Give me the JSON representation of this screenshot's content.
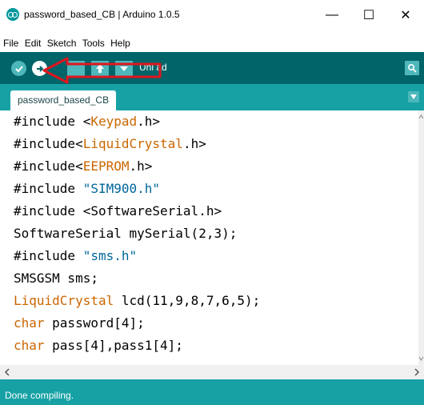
{
  "window": {
    "title": "password_based_CB | Arduino 1.0.5",
    "minimize": "—",
    "maximize": "☐",
    "close": "✕"
  },
  "menu": [
    "File",
    "Edit",
    "Sketch",
    "Tools",
    "Help"
  ],
  "toolbar": {
    "hover_label": "Unl  ad",
    "accent_color": "#006468",
    "arrow_color": "#e0161f"
  },
  "tabs": [
    {
      "label": "password_based_CB"
    }
  ],
  "code": [
    [
      {
        "t": "#include ",
        "c": "#000000"
      },
      {
        "t": "<",
        "c": "#000000"
      },
      {
        "t": "Keypad",
        "c": "#cc6600"
      },
      {
        "t": ".h>",
        "c": "#000000"
      }
    ],
    [
      {
        "t": "#include<",
        "c": "#000000"
      },
      {
        "t": "LiquidCrystal",
        "c": "#cc6600"
      },
      {
        "t": ".h>",
        "c": "#000000"
      }
    ],
    [
      {
        "t": "#include<",
        "c": "#000000"
      },
      {
        "t": "EEPROM",
        "c": "#cc6600"
      },
      {
        "t": ".h>",
        "c": "#000000"
      }
    ],
    [
      {
        "t": "#include ",
        "c": "#000000"
      },
      {
        "t": "\"SIM900.h\"",
        "c": "#006699"
      }
    ],
    [
      {
        "t": "#include <SoftwareSerial.h>",
        "c": "#000000"
      }
    ],
    [
      {
        "t": "SoftwareSerial mySerial(2,3);",
        "c": "#000000"
      }
    ],
    [
      {
        "t": "#include ",
        "c": "#000000"
      },
      {
        "t": "\"sms.h\"",
        "c": "#006699"
      }
    ],
    [
      {
        "t": "SMSGSM sms;",
        "c": "#000000"
      }
    ],
    [
      {
        "t": "LiquidCrystal",
        "c": "#cc6600"
      },
      {
        "t": " lcd(11,9,8,7,6,5);",
        "c": "#000000"
      }
    ],
    [
      {
        "t": "char",
        "c": "#cc6600"
      },
      {
        "t": " password[4];",
        "c": "#000000"
      }
    ],
    [
      {
        "t": "char",
        "c": "#cc6600"
      },
      {
        "t": " pass[4],pass1[4];",
        "c": "#000000"
      }
    ]
  ],
  "status": {
    "message": "Done compiling."
  }
}
